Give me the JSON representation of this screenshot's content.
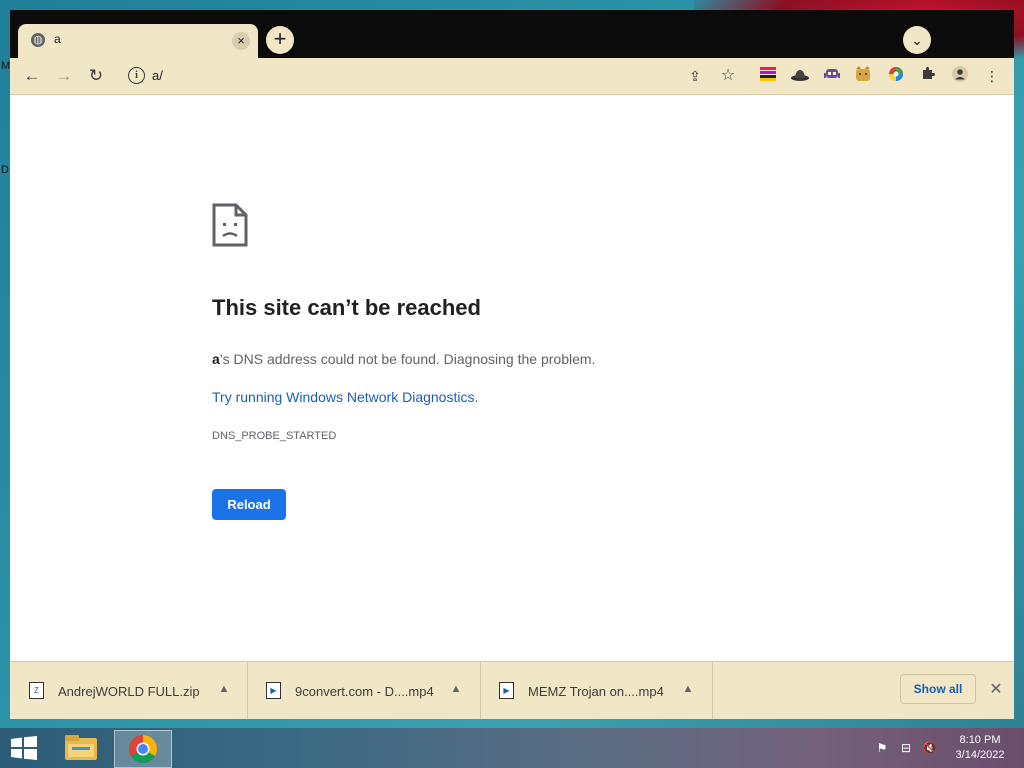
{
  "desktop": {
    "edge_letters": [
      "M",
      "D"
    ]
  },
  "browser": {
    "tab": {
      "title": "a",
      "favicon": "globe-icon"
    },
    "url": "a/",
    "extensions": [
      "rainbow-bars-icon",
      "hat-icon",
      "alien-icon",
      "doge-icon",
      "color-wheel-icon",
      "puzzle-icon",
      "profile-icon",
      "menu-dots-icon"
    ]
  },
  "error_page": {
    "title": "This site can’t be reached",
    "host": "a",
    "description_rest": "’s DNS address could not be found. Diagnosing the problem.",
    "link_text": "Try running Windows Network Diagnostics.",
    "error_code": "DNS_PROBE_STARTED",
    "reload_label": "Reload"
  },
  "downloads": {
    "items": [
      {
        "name": "AndrejWORLD FULL.zip"
      },
      {
        "name": "9convert.com - D....mp4"
      },
      {
        "name": "MEMZ Trojan on....mp4"
      }
    ],
    "show_all_label": "Show all"
  },
  "taskbar": {
    "clock_time": "8:10 PM",
    "clock_date": "3/14/2022"
  },
  "colors": {
    "accent_blue": "#1a73e8",
    "toolbar_bg": "#f1e6c6",
    "link_blue": "#1a5fb4"
  }
}
